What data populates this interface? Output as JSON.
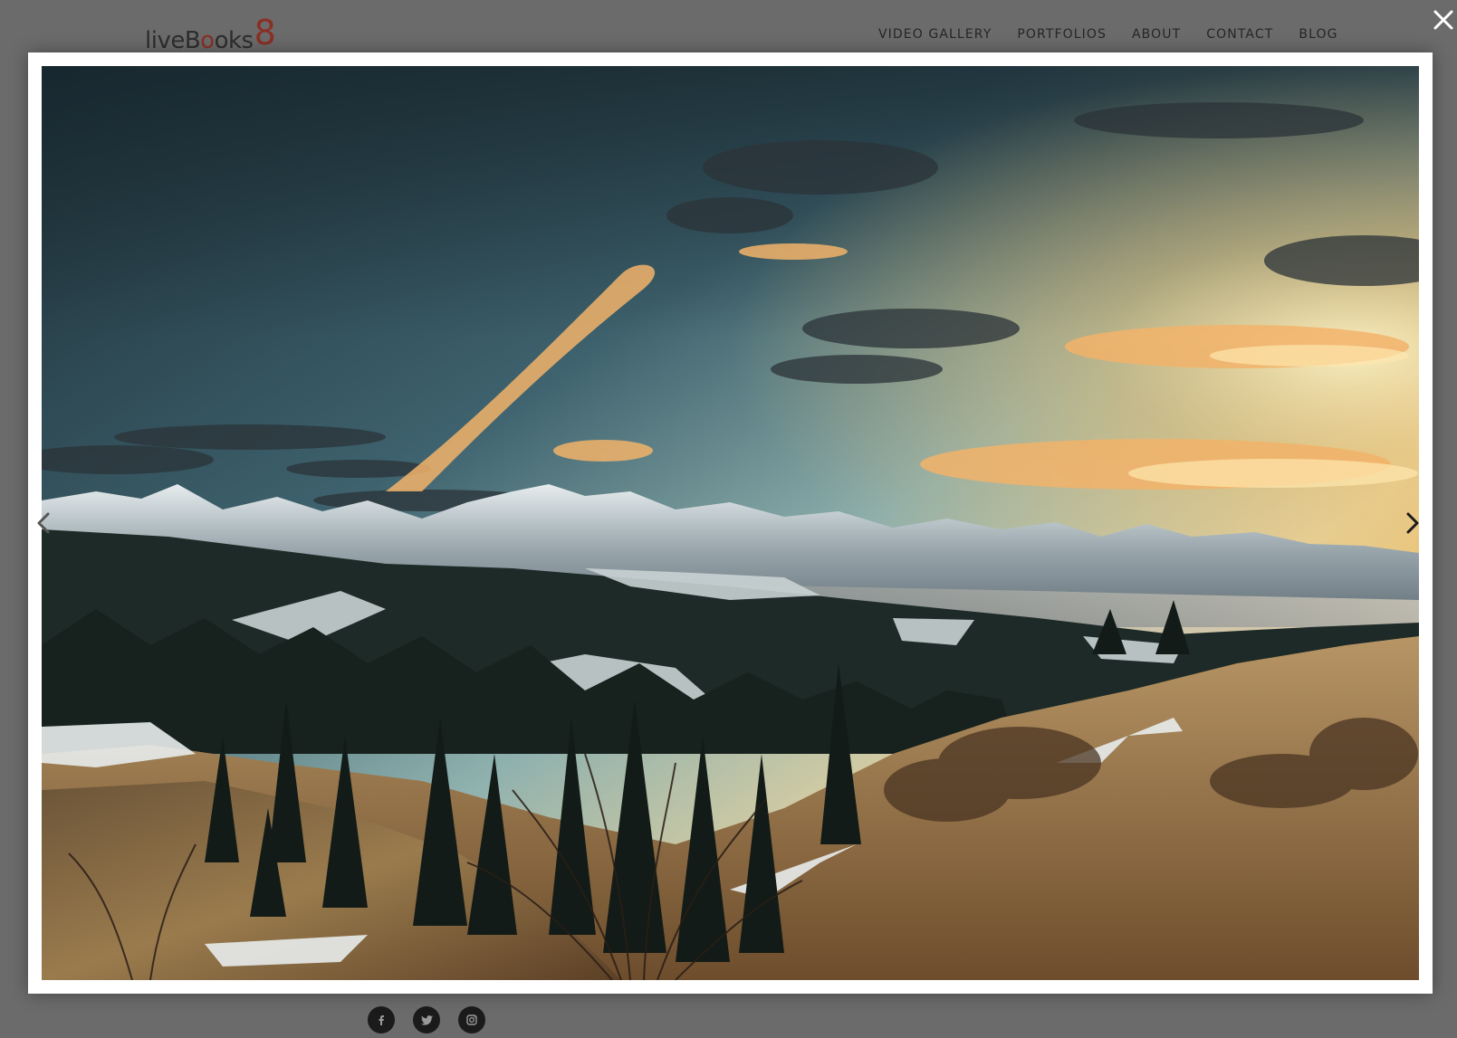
{
  "site": {
    "logo_text": "liveBooks8",
    "nav": [
      {
        "label": "VIDEO GALLERY"
      },
      {
        "label": "PORTFOLIOS"
      },
      {
        "label": "ABOUT"
      },
      {
        "label": "CONTACT"
      },
      {
        "label": "BLOG"
      }
    ],
    "social": [
      {
        "icon": "facebook-icon"
      },
      {
        "icon": "twitter-icon"
      },
      {
        "icon": "instagram-icon"
      }
    ]
  },
  "lightbox": {
    "photo_subject": "mountain-landscape-sunset",
    "controls": {
      "close_icon": "close-icon",
      "prev_icon": "chevron-left-icon",
      "next_icon": "chevron-right-icon"
    }
  },
  "colors": {
    "overlay_background": "#6b6b6b",
    "frame": "#ffffff",
    "logo_accent": "#8a2f24"
  }
}
